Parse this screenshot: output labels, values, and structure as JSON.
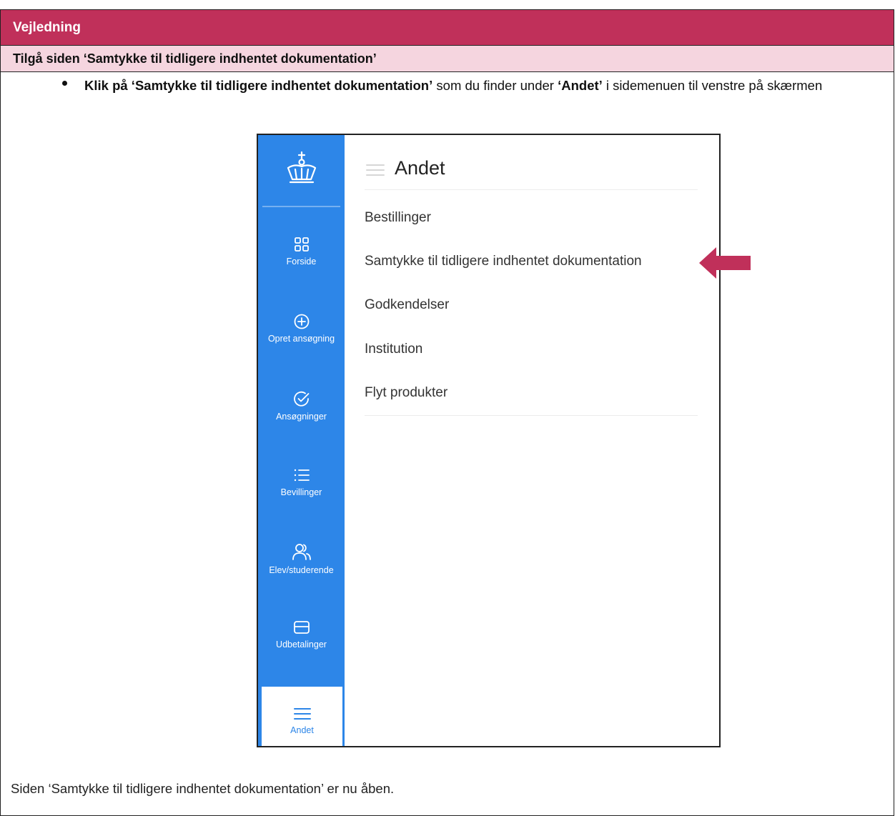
{
  "header": {
    "title": "Vejledning"
  },
  "subheader": {
    "title": "Tilgå siden  ‘Samtykke til tidligere indhentet dokumentation’"
  },
  "instruction": {
    "part1": "Klik på ‘Samtykke til tidligere indhentet dokumentation’",
    "part2": " som du finder under ",
    "part3": "‘Andet’",
    "part4": " i sidemenuen til venstre på skærmen"
  },
  "screenshot": {
    "sidebar": {
      "items": [
        {
          "label": "Forside",
          "icon": "grid-icon"
        },
        {
          "label": "Opret ansøgning",
          "icon": "plus-circle-icon"
        },
        {
          "label": "Ansøgninger",
          "icon": "check-circle-icon"
        },
        {
          "label": "Bevillinger",
          "icon": "list-icon"
        },
        {
          "label": "Elev/studerende",
          "icon": "users-icon"
        },
        {
          "label": "Udbetalinger",
          "icon": "card-icon"
        },
        {
          "label": "Andet",
          "icon": "menu-icon",
          "active": true
        }
      ]
    },
    "panel": {
      "title": "Andet",
      "links": [
        "Bestillinger",
        "Samtykke til tidligere indhentet dokumentation",
        "Godkendelser",
        "Institution",
        "Flyt produkter"
      ]
    }
  },
  "footer": {
    "text": "Siden ‘Samtykke til tidligere indhentet dokumentation’ er nu åben."
  },
  "colors": {
    "header": "#c0305a",
    "subheader": "#f5d5df",
    "sidebar": "#2d86e8",
    "arrow": "#c0305a"
  }
}
